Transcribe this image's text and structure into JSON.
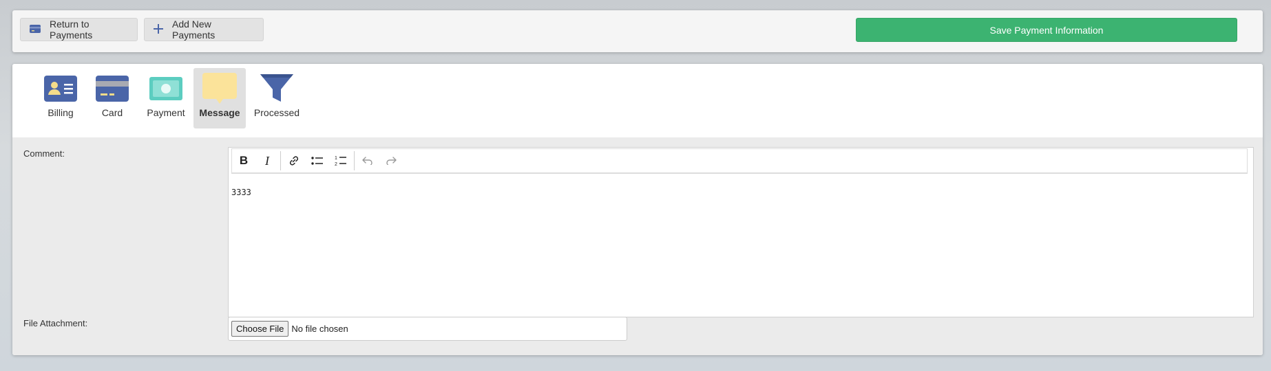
{
  "toolbar": {
    "return_label": "Return to Payments",
    "add_label": "Add New Payments",
    "save_label": "Save Payment Information"
  },
  "tabs": [
    {
      "label": "Billing",
      "icon": "billing-id-card-icon",
      "active": false
    },
    {
      "label": "Card",
      "icon": "credit-card-icon",
      "active": false
    },
    {
      "label": "Payment",
      "icon": "cash-icon",
      "active": false
    },
    {
      "label": "Message",
      "icon": "message-bubble-icon",
      "active": true
    },
    {
      "label": "Processed",
      "icon": "funnel-icon",
      "active": false
    }
  ],
  "form": {
    "comment_label": "Comment:",
    "comment_value": "3333",
    "file_label": "File Attachment:",
    "choose_file_label": "Choose File",
    "no_file_text": "No file chosen"
  },
  "colors": {
    "save_button": "#3cb371",
    "icon_blue": "#4a65a8",
    "message_yellow": "#fbe39a",
    "payment_teal": "#5ccdc0"
  }
}
